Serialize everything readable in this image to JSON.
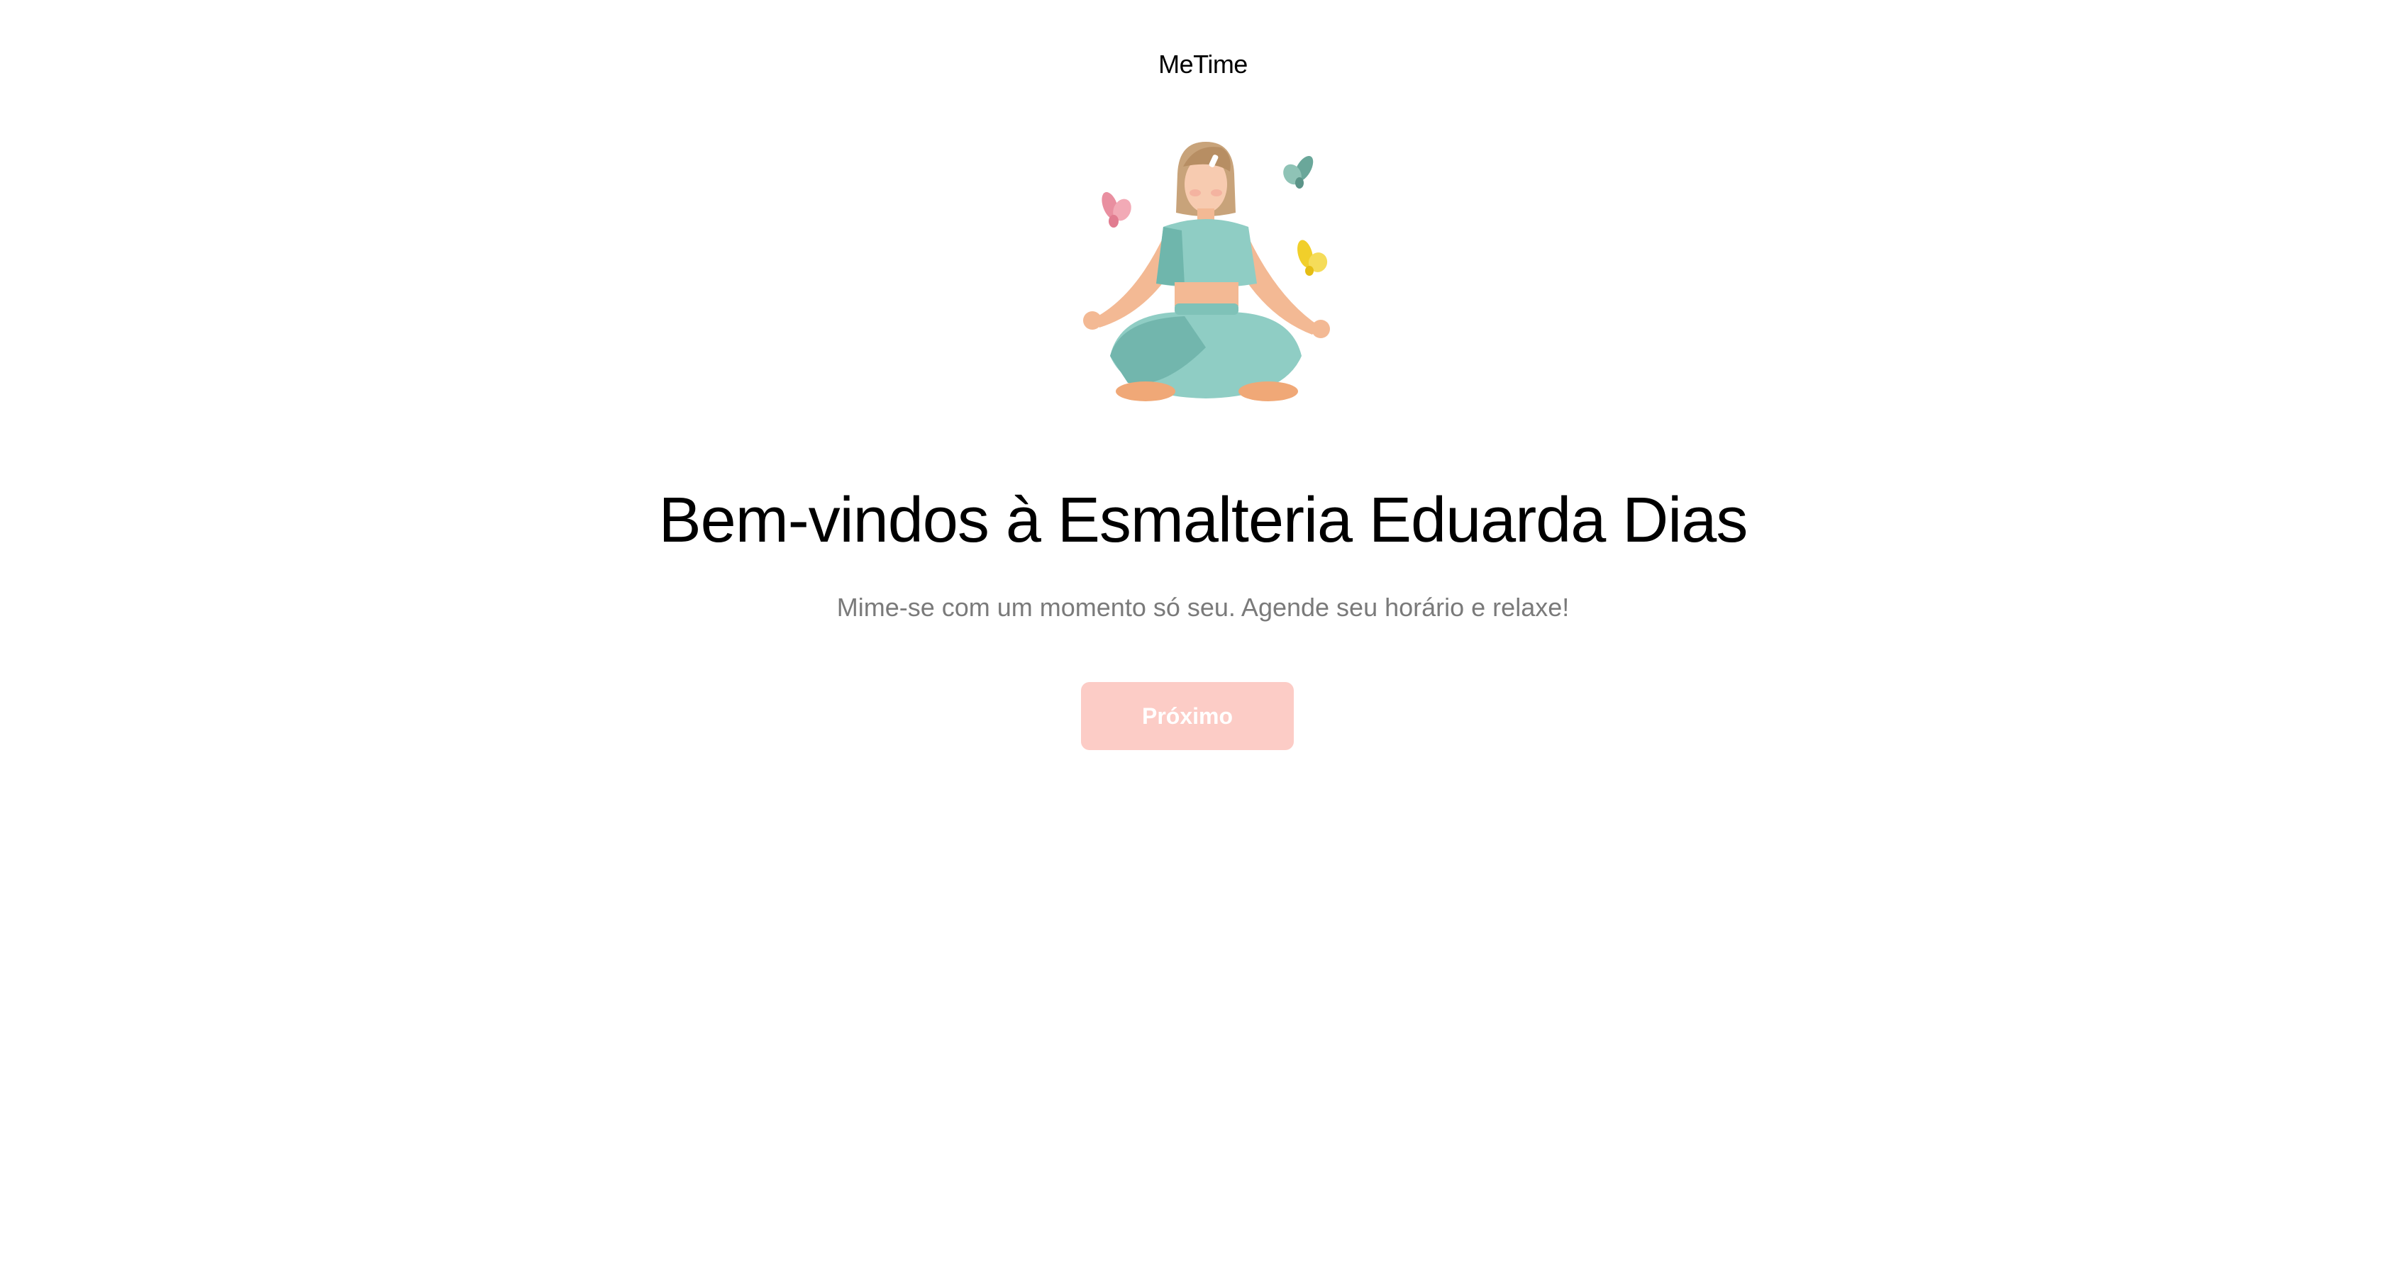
{
  "header": {
    "brand": "MeTime"
  },
  "hero": {
    "illustration": "woman-meditating-with-butterflies"
  },
  "main": {
    "title": "Bem-vindos à Esmalteria Eduarda Dias",
    "subtitle": "Mime-se com um momento só seu. Agende seu horário e relaxe!",
    "next_label": "Próximo"
  },
  "colors": {
    "background": "#ffffff",
    "title": "#000000",
    "subtitle": "#7a7a7a",
    "button_bg": "#fcccc6",
    "button_text": "#ffffff",
    "outfit": "#8fcdc4",
    "skin": "#f3b994",
    "hair": "#c8a37a"
  }
}
